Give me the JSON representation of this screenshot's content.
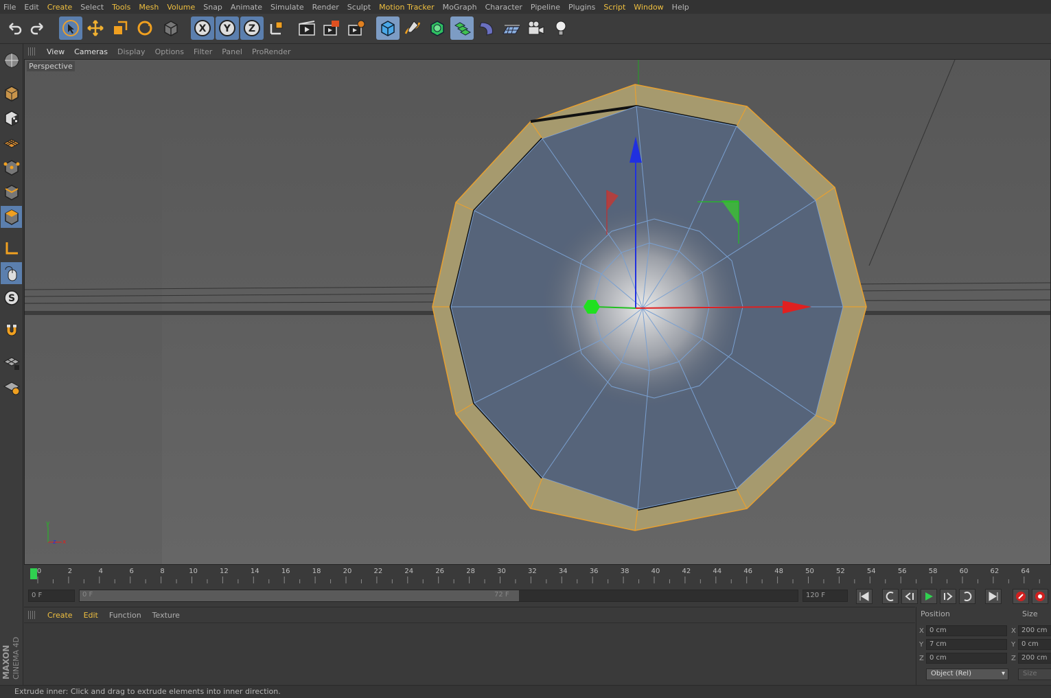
{
  "menu": [
    "File",
    "Edit",
    "Create",
    "Select",
    "Tools",
    "Mesh",
    "Volume",
    "Snap",
    "Animate",
    "Simulate",
    "Render",
    "Sculpt",
    "Motion Tracker",
    "MoGraph",
    "Character",
    "Pipeline",
    "Plugins",
    "Script",
    "Window",
    "Help"
  ],
  "viewport_menu": [
    "View",
    "Cameras",
    "Display",
    "Options",
    "Filter",
    "Panel",
    "ProRender"
  ],
  "viewport_label": "Perspective",
  "timeline_ticks": [
    "0",
    "2",
    "4",
    "6",
    "8",
    "10",
    "12",
    "14",
    "16",
    "18",
    "20",
    "22",
    "24",
    "26",
    "28",
    "30",
    "32",
    "34",
    "36",
    "38",
    "40",
    "42",
    "44",
    "46",
    "48",
    "50",
    "52",
    "54",
    "56",
    "58",
    "60",
    "62",
    "64",
    "6"
  ],
  "transport": {
    "current_frame": "0 F",
    "range_start": "0 F",
    "range_mid": "72 F",
    "end_frame": "120 F"
  },
  "material_menu": [
    "Create",
    "Edit",
    "Function",
    "Texture"
  ],
  "coords": {
    "position_label": "Position",
    "size_label": "Size",
    "axes": [
      "X",
      "Y",
      "Z"
    ],
    "position": [
      "0 cm",
      "7 cm",
      "0 cm"
    ],
    "size": [
      "200 cm",
      "0 cm",
      "200 cm"
    ],
    "mode": "Object (Rel)",
    "size_button": "Size"
  },
  "logo_text": {
    "maxon": "MAXON",
    "cinema": "CINEMA 4D"
  },
  "status": "Extrude inner: Click and drag to extrude elements into inner direction.",
  "colors": {
    "accent_yellow": "#f0c040",
    "selection_orange": "#e8a030",
    "axis_x": "#e02020",
    "axis_y": "#20c020",
    "axis_z": "#2030e0",
    "mesh_blue": "#5a6e88"
  }
}
